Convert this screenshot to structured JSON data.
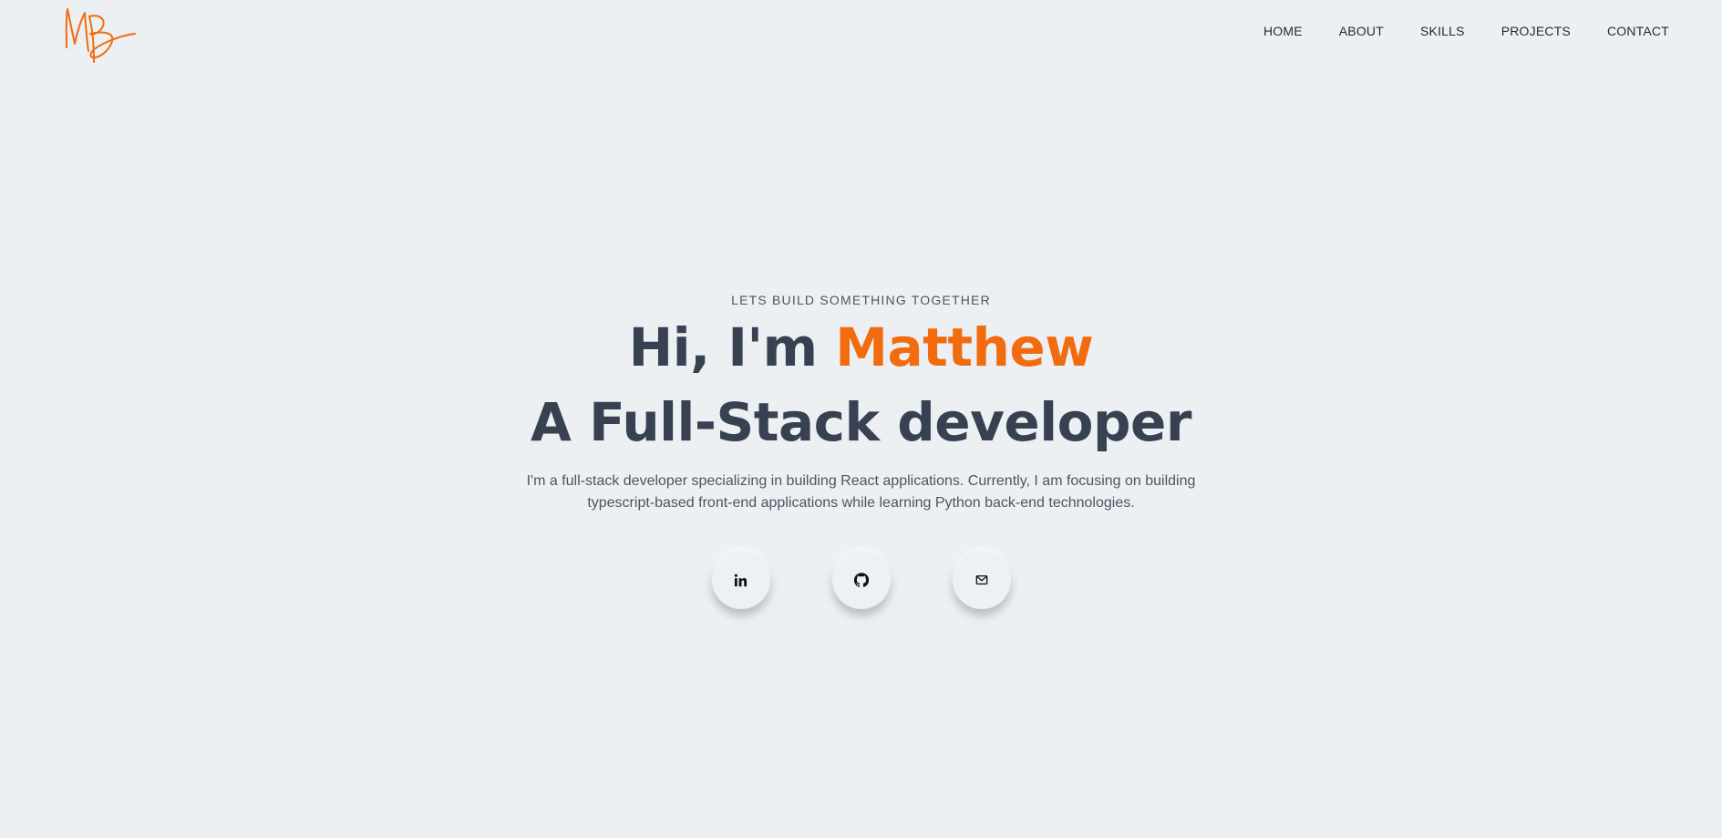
{
  "brand": {
    "logo_initials": "MB",
    "accent_color": "#f26b0f"
  },
  "nav": {
    "items": [
      "HOME",
      "ABOUT",
      "SKILLS",
      "PROJECTS",
      "CONTACT"
    ]
  },
  "hero": {
    "eyebrow": "LETS BUILD SOMETHING TOGETHER",
    "greeting": "Hi, I'm ",
    "name": "Matthew",
    "role": "A Full-Stack developer",
    "intro": "I'm a full-stack developer specializing in building React applications. Currently, I am focusing on building typescript-based front-end applications while learning Python back-end technologies."
  },
  "socials": [
    {
      "icon": "linkedin-icon"
    },
    {
      "icon": "github-icon"
    },
    {
      "icon": "mail-icon"
    }
  ]
}
